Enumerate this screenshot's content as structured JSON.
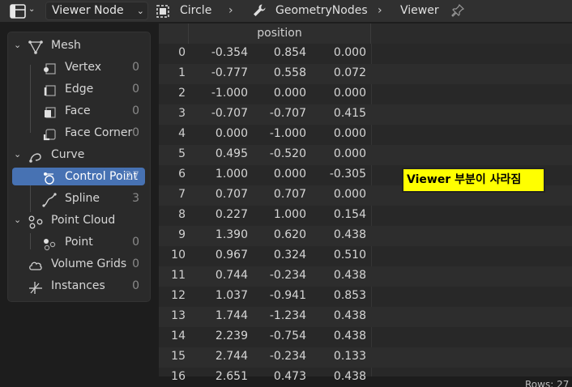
{
  "header": {
    "viewer_select": "Viewer Node",
    "breadcrumb": [
      {
        "label": "Circle",
        "icon": "object-icon"
      },
      {
        "label": "GeometryNodes",
        "icon": "wrench-icon"
      },
      {
        "label": "Viewer",
        "icon": ""
      }
    ]
  },
  "tree": [
    {
      "label": "Mesh",
      "count": "",
      "level": 0,
      "icon": "mesh-icon",
      "expanded": true
    },
    {
      "label": "Vertex",
      "count": "0",
      "level": 1,
      "icon": "vertex-icon"
    },
    {
      "label": "Edge",
      "count": "0",
      "level": 1,
      "icon": "edge-icon"
    },
    {
      "label": "Face",
      "count": "0",
      "level": 1,
      "icon": "face-icon"
    },
    {
      "label": "Face Corner",
      "count": "0",
      "level": 1,
      "icon": "face-corner-icon"
    },
    {
      "label": "Curve",
      "count": "",
      "level": 0,
      "icon": "curve-icon",
      "expanded": true
    },
    {
      "label": "Control Point",
      "count": "27",
      "level": 1,
      "icon": "control-point-icon",
      "selected": true
    },
    {
      "label": "Spline",
      "count": "3",
      "level": 1,
      "icon": "spline-icon"
    },
    {
      "label": "Point Cloud",
      "count": "",
      "level": 0,
      "icon": "point-cloud-icon",
      "expanded": true
    },
    {
      "label": "Point",
      "count": "0",
      "level": 1,
      "icon": "point-icon"
    },
    {
      "label": "Volume Grids",
      "count": "0",
      "level": 0,
      "icon": "volume-icon"
    },
    {
      "label": "Instances",
      "count": "0",
      "level": 0,
      "icon": "instances-icon"
    }
  ],
  "table": {
    "column": "position",
    "rows": [
      [
        "0",
        "-0.354",
        "0.854",
        "0.000"
      ],
      [
        "1",
        "-0.777",
        "0.558",
        "0.072"
      ],
      [
        "2",
        "-1.000",
        "0.000",
        "0.000"
      ],
      [
        "3",
        "-0.707",
        "-0.707",
        "0.415"
      ],
      [
        "4",
        "0.000",
        "-1.000",
        "0.000"
      ],
      [
        "5",
        "0.495",
        "-0.520",
        "0.000"
      ],
      [
        "6",
        "1.000",
        "0.000",
        "-0.305"
      ],
      [
        "7",
        "0.707",
        "0.707",
        "0.000"
      ],
      [
        "8",
        "0.227",
        "1.000",
        "0.154"
      ],
      [
        "9",
        "1.390",
        "0.620",
        "0.438"
      ],
      [
        "10",
        "0.967",
        "0.324",
        "0.510"
      ],
      [
        "11",
        "0.744",
        "-0.234",
        "0.438"
      ],
      [
        "12",
        "1.037",
        "-0.941",
        "0.853"
      ],
      [
        "13",
        "1.744",
        "-1.234",
        "0.438"
      ],
      [
        "14",
        "2.239",
        "-0.754",
        "0.438"
      ],
      [
        "15",
        "2.744",
        "-0.234",
        "0.133"
      ],
      [
        "16",
        "2.651",
        "0.473",
        "0.438"
      ]
    ]
  },
  "annotation": "Viewer 부분이 사라짐",
  "footer": "Rows: 27",
  "colors": {
    "selection": "#4772b3",
    "annotation_bg": "#ffff00"
  }
}
